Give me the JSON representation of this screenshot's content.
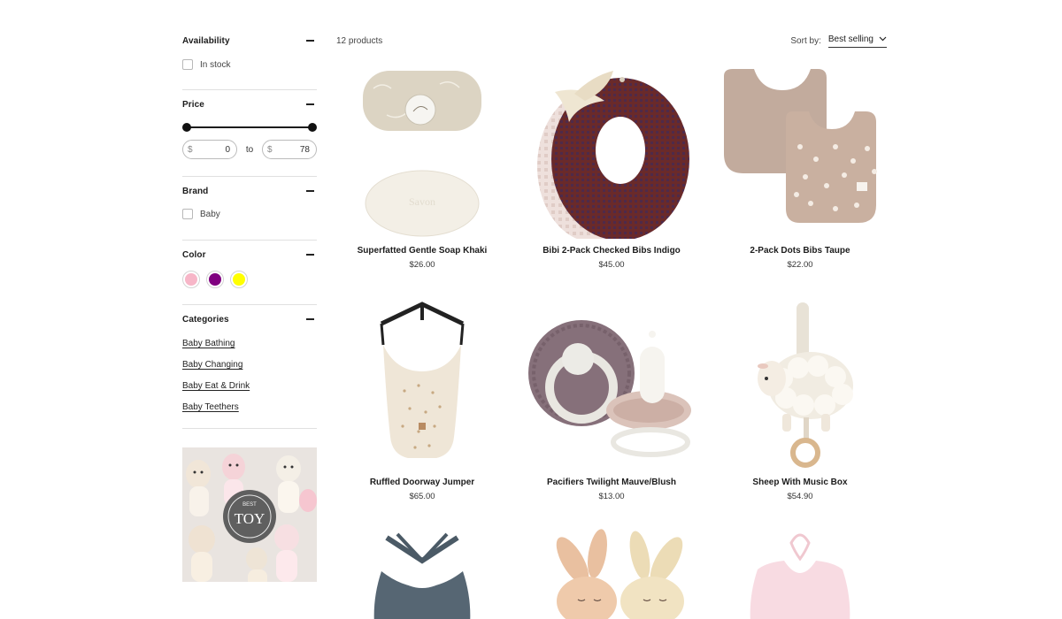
{
  "filters": {
    "availability": {
      "title": "Availability",
      "option": "In stock"
    },
    "price": {
      "title": "Price",
      "currency": "$",
      "min": "0",
      "max": "78",
      "to_label": "to"
    },
    "brand": {
      "title": "Brand",
      "option": "Baby"
    },
    "color": {
      "title": "Color",
      "swatches": [
        "#f7b6c8",
        "#800080",
        "#ffff00"
      ]
    },
    "categories": {
      "title": "Categories",
      "items": [
        "Baby Bathing",
        "Baby Changing",
        "Baby Eat & Drink",
        "Baby Teethers"
      ]
    }
  },
  "promo": {
    "badge_text": "TOY",
    "badge_small": "BEST"
  },
  "toolbar": {
    "product_count": "12 products",
    "sort_label": "Sort by:",
    "sort_value": "Best selling"
  },
  "products": [
    {
      "name": "Superfatted Gentle Soap Khaki",
      "price": "$26.00"
    },
    {
      "name": "Bibi 2-Pack Checked Bibs Indigo",
      "price": "$45.00"
    },
    {
      "name": "2-Pack Dots Bibs Taupe",
      "price": "$22.00"
    },
    {
      "name": "Ruffled Doorway Jumper",
      "price": "$65.00"
    },
    {
      "name": "Pacifiers Twilight Mauve/Blush",
      "price": "$13.00"
    },
    {
      "name": "Sheep With Music Box",
      "price": "$54.90"
    }
  ]
}
